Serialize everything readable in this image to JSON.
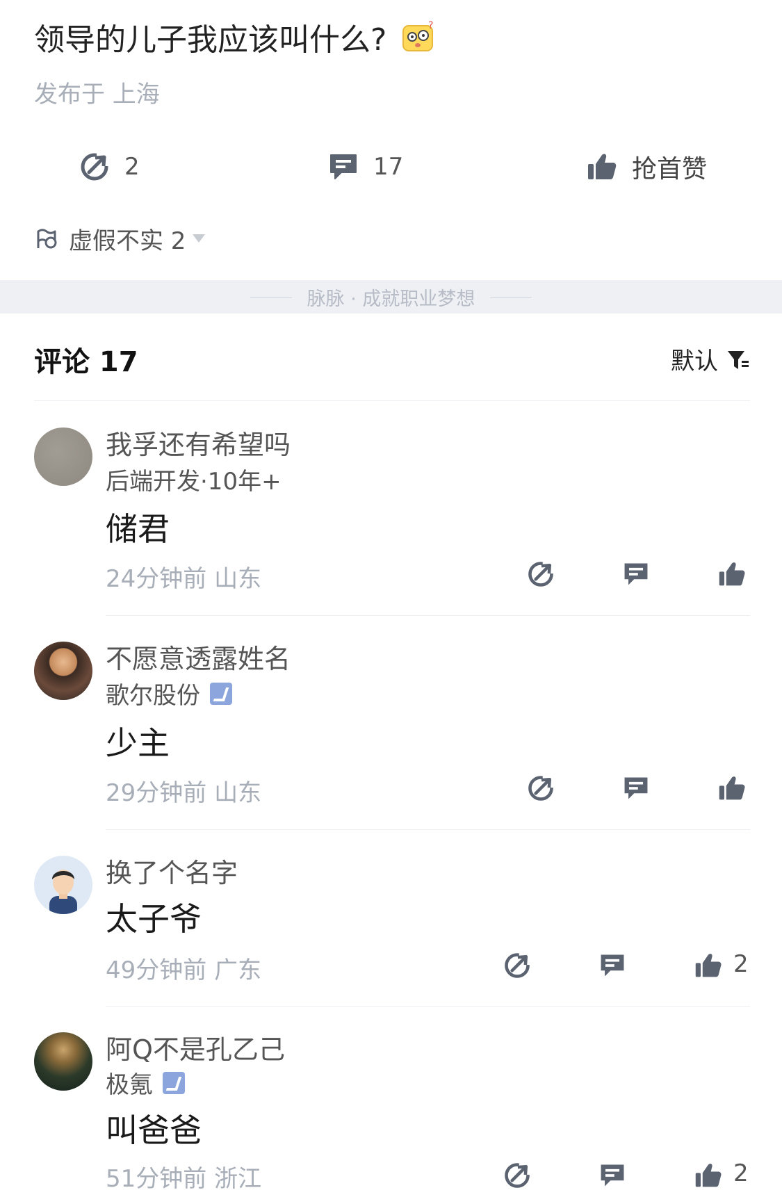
{
  "post": {
    "title": "领导的儿子我应该叫什么?",
    "meta": "发布于 上海"
  },
  "actions": {
    "share_count": "2",
    "comment_count": "17",
    "like_label": "抢首赞"
  },
  "tag": {
    "label": "虚假不实 2"
  },
  "brand_band": "脉脉 · 成就职业梦想",
  "comments_header": {
    "title": "评论 17",
    "sort_label": "默认"
  },
  "comments": [
    {
      "name": "我孚还有希望吗",
      "sub": "后端开发·10年+",
      "verified": false,
      "body": "储君",
      "time": "24分钟前 山东",
      "likes": ""
    },
    {
      "name": "不愿意透露姓名",
      "sub": "歌尔股份",
      "verified": true,
      "body": "少主",
      "time": "29分钟前 山东",
      "likes": ""
    },
    {
      "name": "换了个名字",
      "sub": "",
      "verified": false,
      "body": "太子爷",
      "time": "49分钟前 广东",
      "likes": "2"
    },
    {
      "name": "阿Q不是孔乙己",
      "sub": "极氪",
      "verified": true,
      "body": "叫爸爸",
      "time": "51分钟前 浙江",
      "likes": "2"
    }
  ],
  "colors": {
    "icon": "#5b6270",
    "muted_text": "#a8aeb8",
    "band_bg": "#eef0f4",
    "verified_badge": "#8ca6dd"
  },
  "icons": [
    "share-icon",
    "comment-icon",
    "thumbs-up-icon",
    "flag-icon",
    "filter-icon",
    "emoji-icon",
    "verified-icon"
  ]
}
